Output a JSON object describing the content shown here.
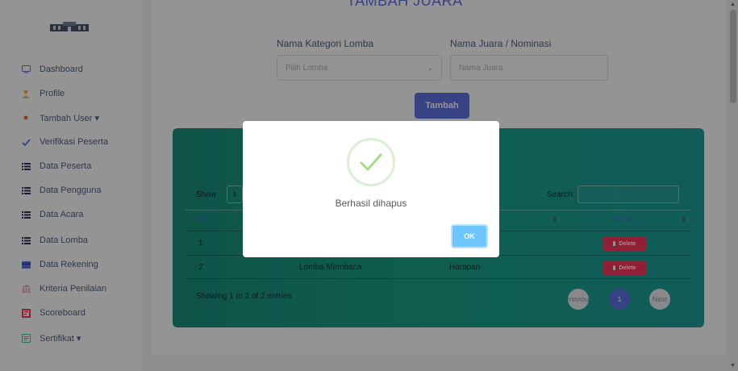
{
  "sidebar": {
    "items": [
      {
        "label": "Dashboard",
        "icon": "monitor-icon"
      },
      {
        "label": "Profile",
        "icon": "user-icon"
      },
      {
        "label": "Tambah User ▾",
        "icon": "spark-icon"
      },
      {
        "label": "Verifikasi Peserta",
        "icon": "check-icon"
      },
      {
        "label": "Data Peserta",
        "icon": "list-icon"
      },
      {
        "label": "Data Pengguna",
        "icon": "list-icon"
      },
      {
        "label": "Data Acara",
        "icon": "list-icon"
      },
      {
        "label": "Data Lomba",
        "icon": "list-icon"
      },
      {
        "label": "Data Rekening",
        "icon": "card-icon"
      },
      {
        "label": "Kriteria Penilaian",
        "icon": "bank-icon"
      },
      {
        "label": "Scoreboard",
        "icon": "scoreboard-icon"
      },
      {
        "label": "Sertifikat ▾",
        "icon": "certificate-icon"
      }
    ]
  },
  "form": {
    "heading": "TAMBAH JUARA",
    "kategori_label": "Nama Kategori Lomba",
    "kategori_value": "Pilih Lomba",
    "juara_label": "Nama Juara / Nominasi",
    "juara_placeholder": "Nama Juara",
    "submit_label": "Tambah"
  },
  "table": {
    "show_label": "Show",
    "search_label": "Search:",
    "headers": [
      "NO.",
      "",
      "",
      "ACTION"
    ],
    "rows": [
      {
        "no": "1",
        "lomba": "",
        "juara": "",
        "action": "Delete"
      },
      {
        "no": "2",
        "lomba": "Lomba Membaca",
        "juara": "Harapan",
        "action": "Delete"
      }
    ],
    "info": "Showing 1 to 2 of 2 entries",
    "pagination": {
      "prev": "Previous",
      "current": "1",
      "next": "Next"
    }
  },
  "modal": {
    "message": "Berhasil dihapus",
    "ok_label": "OK"
  },
  "colors": {
    "primary": "#5e72e4",
    "danger": "#f5365c",
    "success_check": "#a5dc86",
    "card_gradient_start": "#1a8f7e",
    "card_gradient_end": "#1e9e9a"
  }
}
